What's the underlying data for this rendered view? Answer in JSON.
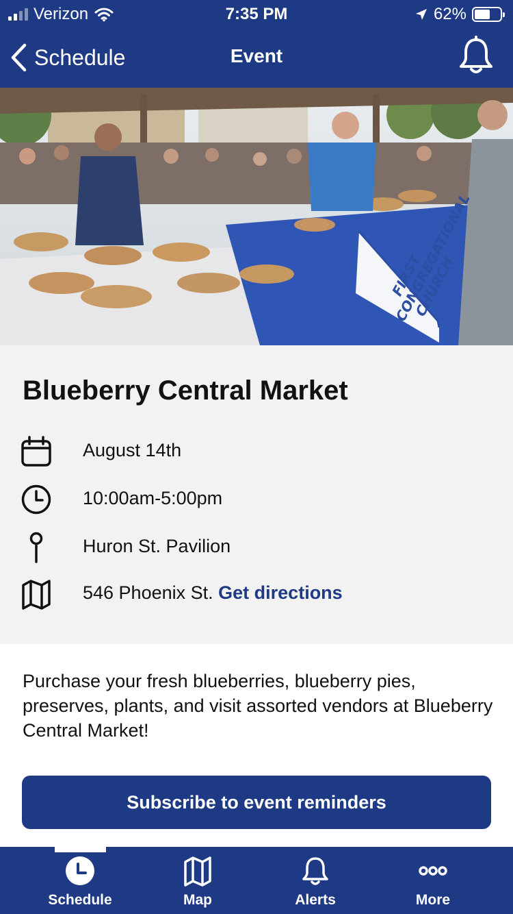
{
  "status_bar": {
    "carrier": "Verizon",
    "time": "7:35 PM",
    "battery_percent": "62%",
    "battery_level": 0.62,
    "icons": [
      "signal-icon",
      "wifi-icon",
      "location-arrow-icon",
      "battery-icon"
    ]
  },
  "nav": {
    "back_label": "Schedule",
    "title": "Event",
    "right_icon": "bell-icon"
  },
  "hero": {
    "icon": "event-photo",
    "banner_lines": [
      "FIRST",
      "CONGREGATIONAL",
      "CHURCH"
    ]
  },
  "event": {
    "title": "Blueberry Central Market",
    "date": "August 14th",
    "time": "10:00am-5:00pm",
    "venue": "Huron St. Pavilion",
    "address": "546 Phoenix St.",
    "directions_label": "Get directions",
    "description": "Purchase your fresh blueberries, blueberry pies, preserves, plants, and visit assorted vendors at Blueberry Central Market!",
    "icons": [
      "calendar-icon",
      "clock-icon",
      "pin-icon",
      "map-icon"
    ]
  },
  "subscribe_button": "Subscribe to event reminders",
  "tabs": [
    {
      "label": "Schedule",
      "icon": "clock-icon",
      "selected": true
    },
    {
      "label": "Map",
      "icon": "map-icon",
      "selected": false
    },
    {
      "label": "Alerts",
      "icon": "bell-icon",
      "selected": false
    },
    {
      "label": "More",
      "icon": "more-icon",
      "selected": false
    }
  ],
  "colors": {
    "brand": "#1f3a84",
    "info_background": "#f2f2f2",
    "text": "#111111",
    "on_brand": "#ffffff"
  }
}
